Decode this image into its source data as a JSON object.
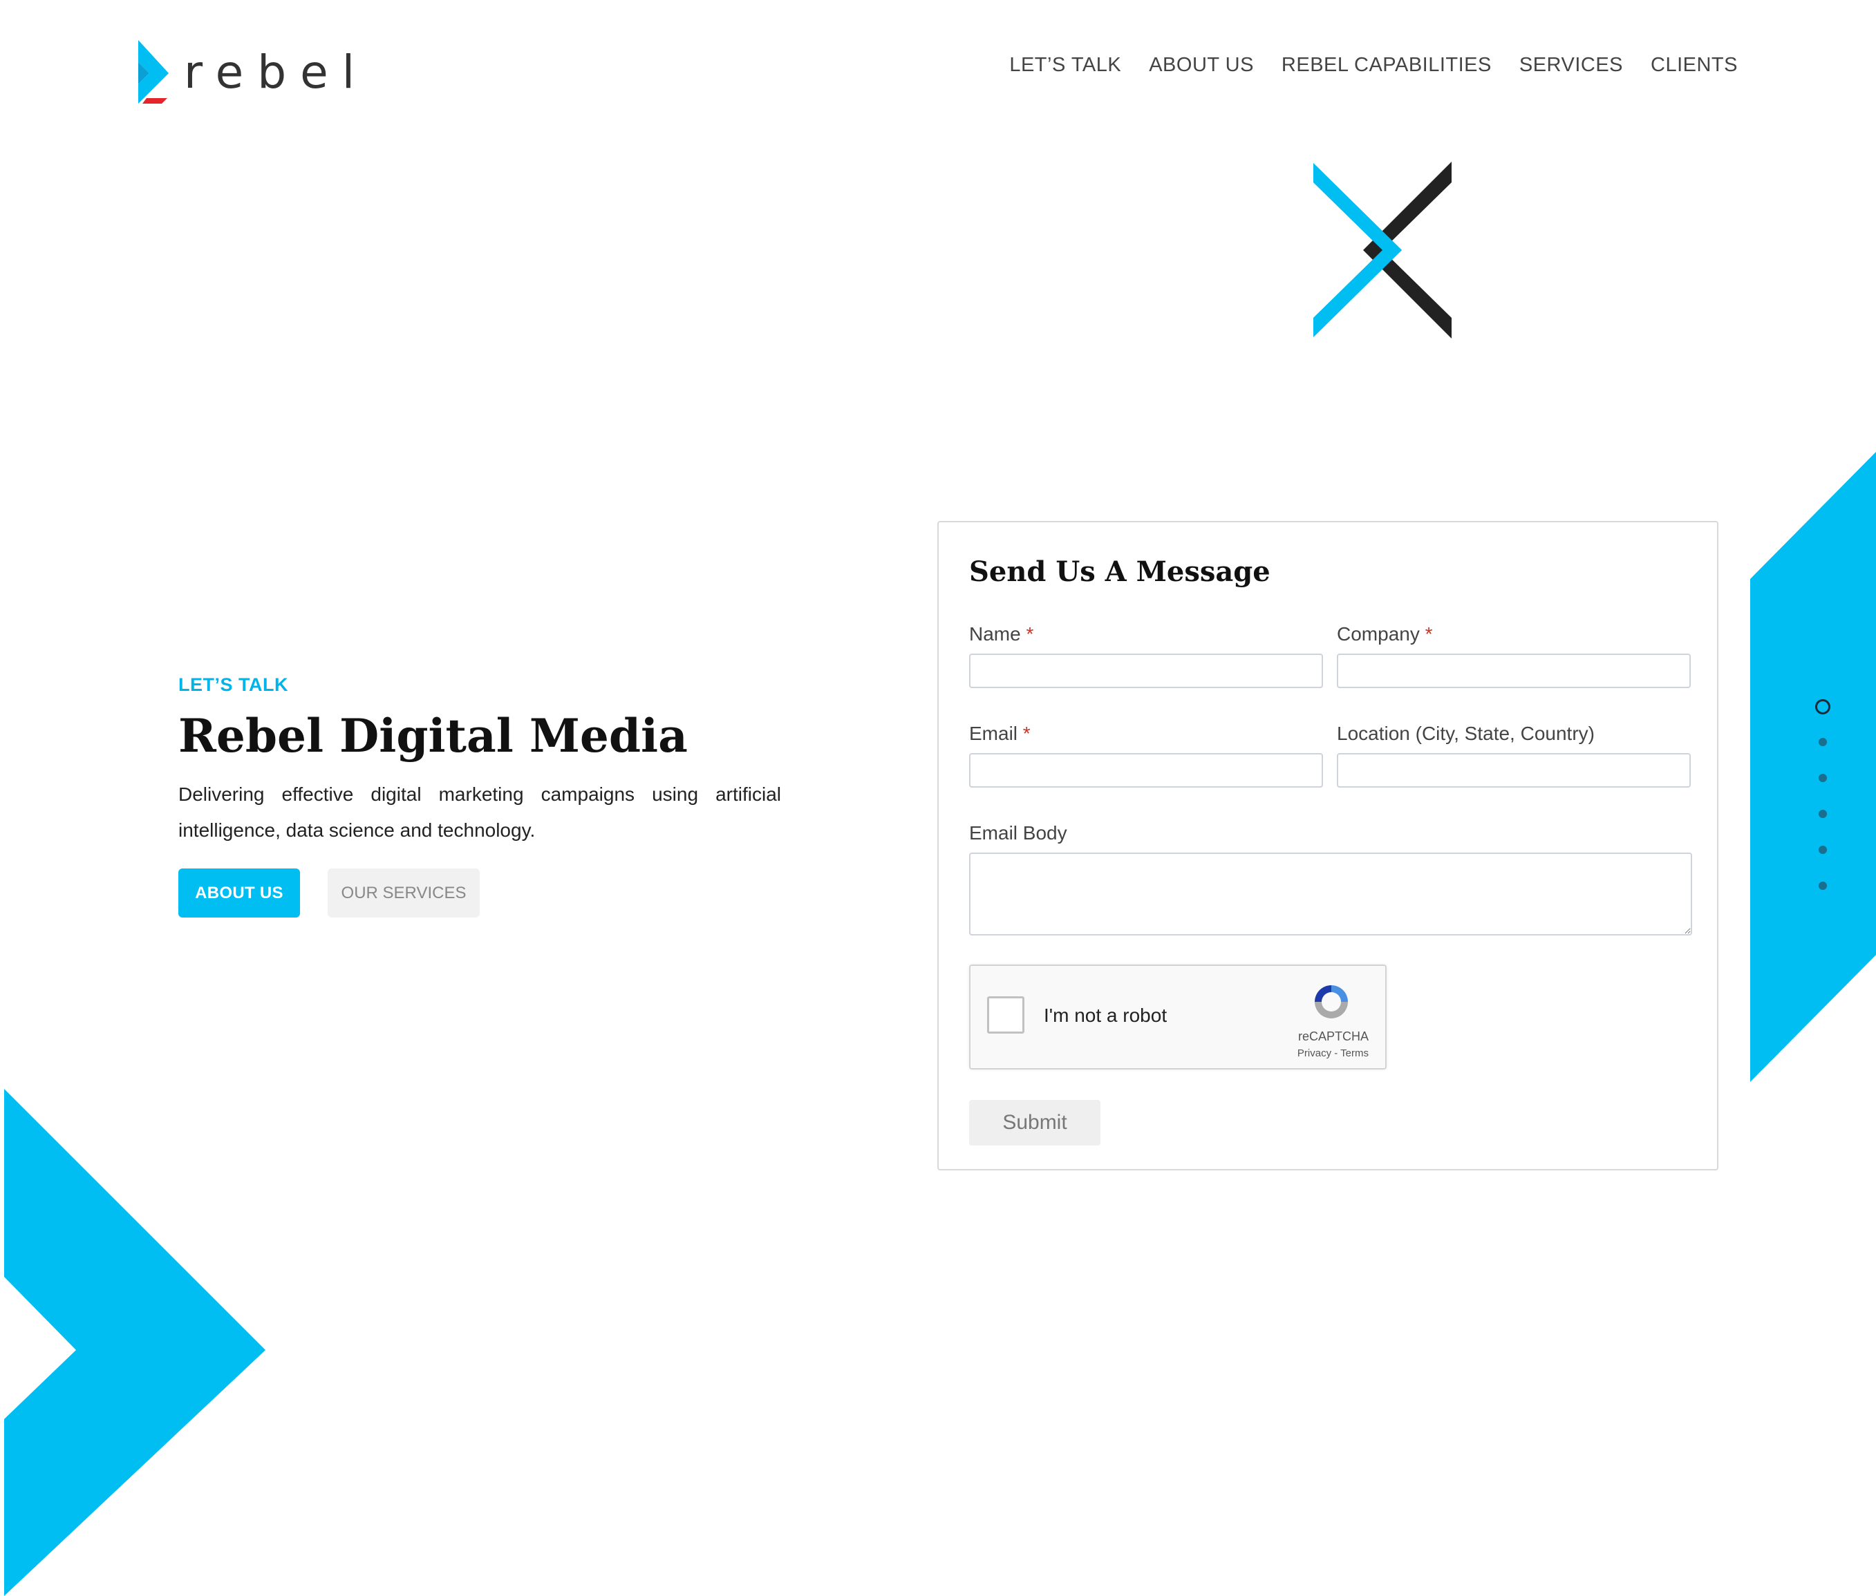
{
  "brand": {
    "logo_text": "rebel",
    "accent": "#00bdf2",
    "dark": "#222222"
  },
  "nav": {
    "items": [
      {
        "label": "LET’S TALK"
      },
      {
        "label": "ABOUT US"
      },
      {
        "label": "REBEL CAPABILITIES"
      },
      {
        "label": "SERVICES"
      },
      {
        "label": "CLIENTS"
      }
    ]
  },
  "hero": {
    "eyebrow": "LET’S TALK",
    "title": "Rebel Digital Media",
    "description": "Delivering effective digital marketing campaigns using artificial intelligence, data science and technology.",
    "primary_button": "ABOUT US",
    "secondary_button": "OUR SERVICES"
  },
  "form": {
    "title": "Send Us A Message",
    "required_mark": "*",
    "name_label": "Name",
    "company_label": "Company",
    "email_label": "Email",
    "location_label": "Location (City, State, Country)",
    "body_label": "Email Body",
    "recaptcha": {
      "text": "I'm not a robot",
      "brand": "reCAPTCHA",
      "links": "Privacy - Terms"
    },
    "submit_label": "Submit"
  },
  "side_nav": {
    "dot_count": 6,
    "active_index": 0
  }
}
